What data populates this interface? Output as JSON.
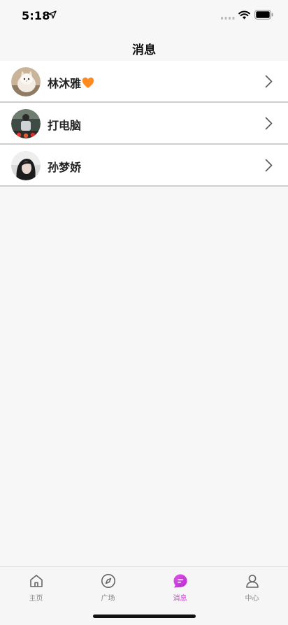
{
  "status_bar": {
    "time": "5:18",
    "icons": [
      "location-arrow-icon",
      "cellular-signal-icon",
      "wifi-icon",
      "battery-icon"
    ]
  },
  "nav": {
    "title": "消息"
  },
  "conversations": [
    {
      "name": "林沐雅",
      "avatar": "avatar-cat",
      "icon": "orange-heart-icon"
    },
    {
      "name": "打电脑",
      "avatar": "avatar-person-dark"
    },
    {
      "name": "孙梦娇",
      "avatar": "avatar-girl"
    }
  ],
  "tab_bar": {
    "items": [
      {
        "label": "主页",
        "icon": "home-icon",
        "active": false
      },
      {
        "label": "广场",
        "icon": "compass-icon",
        "active": false
      },
      {
        "label": "消息",
        "icon": "message-bubble-icon",
        "active": true
      },
      {
        "label": "中心",
        "icon": "person-icon",
        "active": false
      }
    ]
  },
  "colors": {
    "accent": "#d63be0",
    "background": "#f7f7f7",
    "row_background": "#ffffff",
    "divider": "#cfcfcf",
    "inactive_tab": "#888888"
  }
}
